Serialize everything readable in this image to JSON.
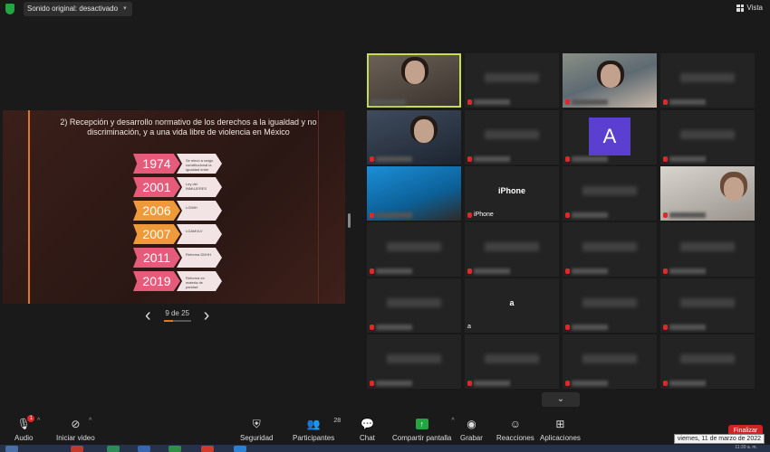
{
  "topbar": {
    "audio_label": "Sonido original: desactivado",
    "view_label": "Vista"
  },
  "slide": {
    "title": "2) Recepción y desarrollo normativo de los derechos a la igualdad y no discriminación, y a una vida libre de violencia en México",
    "timeline": [
      {
        "year": "1974",
        "desc": "Se elevó a rango constitucional la igualdad entre mujeres y hombres (Art. 4º)",
        "color": "pink"
      },
      {
        "year": "2001",
        "desc": "Ley del INMUJERES",
        "color": "pink"
      },
      {
        "year": "2006",
        "desc": "LGIMH",
        "color": "orange"
      },
      {
        "year": "2007",
        "desc": "LGAMVLV",
        "color": "orange"
      },
      {
        "year": "2011",
        "desc": "Reforma DDHH",
        "color": "pink"
      },
      {
        "year": "2019",
        "desc": "Reforma en materia de paridad",
        "color": "pink"
      }
    ],
    "pagination": "9 de 25",
    "progress": 0.36
  },
  "participants": {
    "iphone_label": "iPhone",
    "a_label": "a",
    "avatar_letter": "A"
  },
  "toolbar": {
    "audio": "Audio",
    "audio_badge": "1",
    "video": "Iniciar video",
    "security": "Seguridad",
    "participants": "Participantes",
    "participants_count": "28",
    "chat": "Chat",
    "share": "Compartir pantalla",
    "record": "Grabar",
    "reactions": "Reacciones",
    "apps": "Aplicaciones",
    "end": "Finalizar"
  },
  "tooltip": "viernes, 11 de marzo de 2022",
  "taskbar": {
    "clock": "11:30 a. m."
  },
  "colors": {
    "accent": "#e0781f",
    "pink": "#e65a7a",
    "orange": "#ef9a3a",
    "share_green": "#23a542",
    "end_red": "#d02424",
    "active_outline": "#c6e04a"
  }
}
